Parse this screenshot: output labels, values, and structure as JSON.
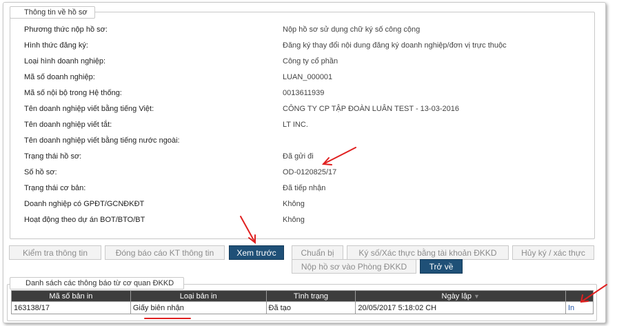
{
  "profile": {
    "legend": "Thông tin về hồ sơ",
    "fields": [
      {
        "label": "Phương thức nộp hồ sơ:",
        "value": "Nộp hồ sơ sử dụng chữ ký số công cộng"
      },
      {
        "label": "Hình thức đăng ký:",
        "value": "Đăng ký thay đổi nội dung đăng ký doanh nghiệp/đơn vị trực thuộc"
      },
      {
        "label": "Loại hình doanh nghiệp:",
        "value": "Công ty cổ phần"
      },
      {
        "label": "Mã số doanh nghiệp:",
        "value": "LUAN_000001"
      },
      {
        "label": "Mã số nội bộ trong Hệ thống:",
        "value": "0013611939"
      },
      {
        "label": "Tên doanh nghiệp viết bằng tiếng Việt:",
        "value": "CÔNG TY CP TẬP ĐOÀN LUÂN TEST - 13-03-2016"
      },
      {
        "label": "Tên doanh nghiệp viết tắt:",
        "value": "LT INC."
      },
      {
        "label": "Tên doanh nghiệp viết bằng tiếng nước ngoài:",
        "value": ""
      },
      {
        "label": "Trạng thái hồ sơ:",
        "value": "Đã gửi đi"
      },
      {
        "label": "Số hồ sơ:",
        "value": "OD-0120825/17"
      },
      {
        "label": "Trạng thái cơ bản:",
        "value": "Đã tiếp nhận"
      },
      {
        "label": "Doanh nghiệp có GPĐT/GCNĐKĐT",
        "value": "Không"
      },
      {
        "label": "Hoạt động theo dự án BOT/BTO/BT",
        "value": "Không"
      }
    ]
  },
  "actions": {
    "check_info": "Kiểm tra thông tin",
    "close_report": "Đóng báo cáo KT thông tin",
    "preview": "Xem trước",
    "prepare": "Chuẩn bị",
    "sign": "Ký số/Xác thực bằng tài khoản ĐKKD",
    "cancel_sign": "Hủy ký / xác thực",
    "submit": "Nộp hồ sơ vào Phòng ĐKKD",
    "back": "Trở về"
  },
  "notices": {
    "legend": "Danh sách các thông báo từ cơ quan ĐKKD",
    "columns": [
      "Mã số bản in",
      "Loại bản in",
      "Tình trạng",
      "Ngày lập"
    ],
    "sort_indicator": "▼",
    "rows": [
      {
        "code": "163138/17",
        "type": "Giấy biên nhận",
        "status": "Đã tạo",
        "date": "20/05/2017 5:18:02 CH",
        "action": "In"
      }
    ]
  },
  "colors": {
    "primary_button": "#1f5077",
    "annotation": "#e02020",
    "table_header": "#3d3d3d"
  }
}
